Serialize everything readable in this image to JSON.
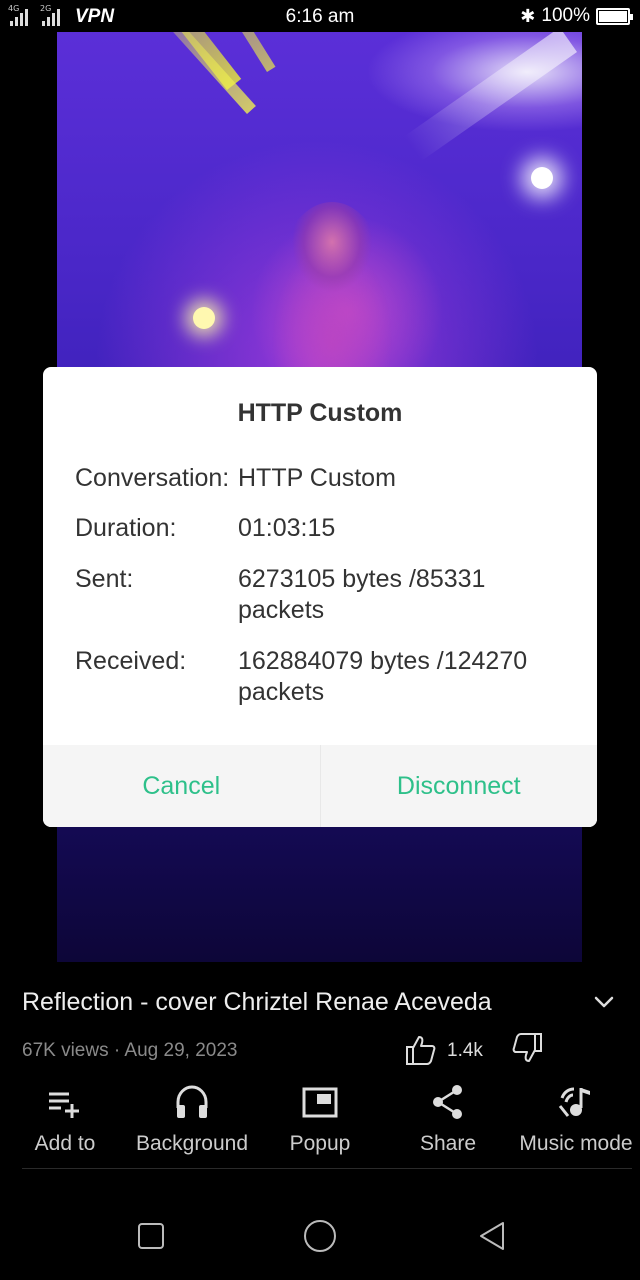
{
  "status_bar": {
    "net1": "4G",
    "net2": "2G",
    "vpn": "VPN",
    "time": "6:16 am",
    "bluetooth_glyph": "✱",
    "battery_pct": "100%"
  },
  "dialog": {
    "title": "HTTP Custom",
    "rows": [
      {
        "key": "Conversation:",
        "value": "HTTP Custom"
      },
      {
        "key": "Duration:",
        "value": "01:03:15"
      },
      {
        "key": "Sent:",
        "value": "6273105 bytes /85331 packets"
      },
      {
        "key": "Received:",
        "value": "162884079 bytes /124270 packets"
      }
    ],
    "cancel_label": "Cancel",
    "disconnect_label": "Disconnect",
    "accent_color": "#2ec08a"
  },
  "video": {
    "title": "Reflection - cover Chriztel Renae Aceveda",
    "meta": "67K views · Aug 29, 2023",
    "likes": "1.4k"
  },
  "actions": [
    {
      "label": "Add to",
      "icon": "playlist-add-icon"
    },
    {
      "label": "Background",
      "icon": "headphones-icon"
    },
    {
      "label": "Popup",
      "icon": "popup-icon"
    },
    {
      "label": "Share",
      "icon": "share-icon"
    },
    {
      "label": "Music mode",
      "icon": "music-mode-icon"
    }
  ],
  "nav": {
    "icons": [
      "recents-square-icon",
      "home-circle-icon",
      "back-triangle-icon"
    ]
  }
}
